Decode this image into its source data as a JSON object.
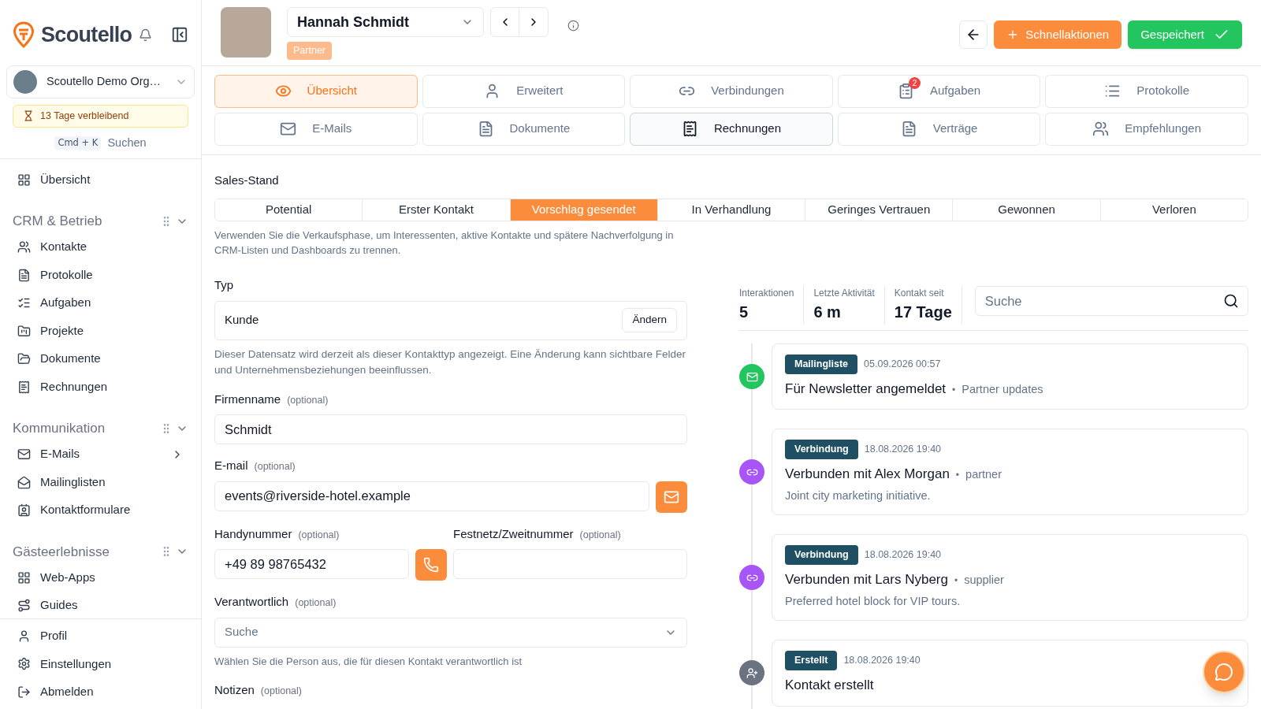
{
  "sidebar": {
    "brand": "Scoutello",
    "org": "Scoutello Demo Org…",
    "trial": "13 Tage verbleibend",
    "shortcut": "Cmd + K",
    "search_label": "Suchen",
    "top_items": [
      {
        "label": "Übersicht"
      }
    ],
    "sections": [
      {
        "title": "CRM & Betrieb",
        "items": [
          {
            "label": "Kontakte",
            "expandable": false
          },
          {
            "label": "Protokolle",
            "expandable": false
          },
          {
            "label": "Aufgaben",
            "expandable": false
          },
          {
            "label": "Projekte",
            "expandable": false
          },
          {
            "label": "Dokumente",
            "expandable": false
          },
          {
            "label": "Rechnungen",
            "expandable": false
          }
        ]
      },
      {
        "title": "Kommunikation",
        "items": [
          {
            "label": "E-Mails",
            "expandable": true
          },
          {
            "label": "Mailinglisten",
            "expandable": false
          },
          {
            "label": "Kontaktformulare",
            "expandable": false
          }
        ]
      },
      {
        "title": "Gästeerlebnisse",
        "items": [
          {
            "label": "Web-Apps",
            "expandable": false
          },
          {
            "label": "Guides",
            "expandable": false
          }
        ]
      }
    ],
    "bottom_items": [
      {
        "label": "Profil"
      },
      {
        "label": "Einstellungen"
      },
      {
        "label": "Abmelden"
      }
    ]
  },
  "header": {
    "contact_name": "Hannah Schmidt",
    "badge": "Partner",
    "quick_actions": "Schnellaktionen",
    "saved": "Gespeichert"
  },
  "tab_rows": [
    [
      {
        "label": "Übersicht",
        "selected": true,
        "hovered": false
      },
      {
        "label": "Erweitert",
        "selected": false,
        "hovered": false
      },
      {
        "label": "Verbindungen",
        "selected": false,
        "hovered": false
      },
      {
        "label": "Aufgaben",
        "selected": false,
        "hovered": false,
        "count": "2"
      },
      {
        "label": "Protokolle",
        "selected": false,
        "hovered": false
      }
    ],
    [
      {
        "label": "E-Mails",
        "selected": false,
        "hovered": false
      },
      {
        "label": "Dokumente",
        "selected": false,
        "hovered": false
      },
      {
        "label": "Rechnungen",
        "selected": false,
        "hovered": true
      },
      {
        "label": "Verträge",
        "selected": false,
        "hovered": false
      },
      {
        "label": "Empfehlungen",
        "selected": false,
        "hovered": false
      }
    ]
  ],
  "sales": {
    "label": "Sales-Stand",
    "stages": [
      {
        "label": "Potential",
        "selected": false
      },
      {
        "label": "Erster Kontakt",
        "selected": false
      },
      {
        "label": "Vorschlag gesendet",
        "selected": true
      },
      {
        "label": "In Verhandlung",
        "selected": false
      },
      {
        "label": "Geringes Vertrauen",
        "selected": false
      },
      {
        "label": "Gewonnen",
        "selected": false
      },
      {
        "label": "Verloren",
        "selected": false
      }
    ],
    "help": "Verwenden Sie die Verkaufsphase, um Interessenten, aktive Kontakte und spätere Nachverfolgung in CRM-Listen und Dashboards zu trennen."
  },
  "form": {
    "type_label": "Typ",
    "type_value": "Kunde",
    "change_button": "Ändern",
    "type_help": "Dieser Datensatz wird derzeit als dieser Kontakttyp angezeigt. Eine Änderung kann sichtbare Felder und Unternehmensbeziehungen beeinflussen.",
    "company_label": "Firmenname",
    "company_optional": "(optional)",
    "company_value": "Schmidt",
    "email_label": "E-mail",
    "email_optional": "(optional)",
    "email_value": "events@riverside-hotel.example",
    "mobile_label": "Handynummer",
    "mobile_optional": "(optional)",
    "mobile_value": "+49 89 98765432",
    "landline_label": "Festnetz/Zweitnummer",
    "landline_optional": "(optional)",
    "owner_label": "Verantwortlich",
    "owner_optional": "(optional)",
    "owner_placeholder": "Suche",
    "owner_help": "Wählen Sie die Person aus, die für diesen Kontakt verantwortlich ist",
    "notes_label": "Notizen",
    "notes_optional": "(optional)"
  },
  "stats": [
    {
      "label": "Interaktionen",
      "value": "5"
    },
    {
      "label": "Letzte Aktivität",
      "value": "6 m"
    },
    {
      "label": "Kontakt seit",
      "value": "17 Tage"
    }
  ],
  "timeline_search": {
    "placeholder": "Suche"
  },
  "timeline": [
    {
      "kind": "mail",
      "color": "#22c55e",
      "tag": "Mailingliste",
      "date": "05.09.2026 00:57",
      "title": "Für Newsletter angemeldet",
      "bullet": "•",
      "meta": "Partner updates"
    },
    {
      "kind": "link",
      "color": "#a855f7",
      "tag": "Verbindung",
      "date": "18.08.2026 19:40",
      "title": "Verbunden mit Alex Morgan",
      "bullet": "•",
      "meta": "partner",
      "note": "Joint city marketing initiative."
    },
    {
      "kind": "link",
      "color": "#a855f7",
      "tag": "Verbindung",
      "date": "18.08.2026 19:40",
      "title": "Verbunden mit Lars Nyberg",
      "bullet": "•",
      "meta": "supplier",
      "note": "Preferred hotel block for VIP tours."
    },
    {
      "kind": "user",
      "color": "#6b7280",
      "tag": "Erstellt",
      "date": "18.08.2026 19:40",
      "title": "Kontakt erstellt"
    }
  ]
}
